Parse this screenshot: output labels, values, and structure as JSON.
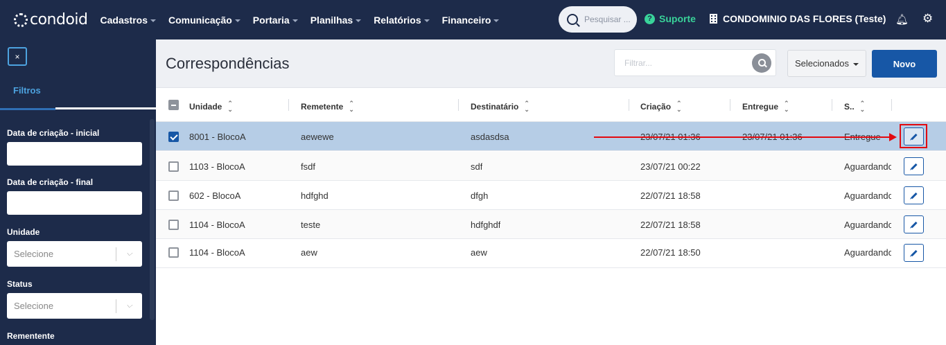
{
  "brand": {
    "name": "condoid"
  },
  "nav": [
    {
      "label": "Cadastros"
    },
    {
      "label": "Comunicação"
    },
    {
      "label": "Portaria"
    },
    {
      "label": "Planilhas"
    },
    {
      "label": "Relatórios"
    },
    {
      "label": "Financeiro"
    }
  ],
  "header": {
    "search_placeholder": "Pesquisar ...",
    "support_label": "Suporte",
    "condo_name": "CONDOMINIO DAS FLORES (Teste)"
  },
  "sidebar": {
    "close_label": "×",
    "tab_label": "Filtros",
    "fields": [
      {
        "label": "Data de criação - inicial",
        "value": ""
      },
      {
        "label": "Data de criação - final",
        "value": ""
      }
    ],
    "selects": [
      {
        "label": "Unidade",
        "value": "Selecione"
      },
      {
        "label": "Status",
        "value": "Selecione"
      }
    ],
    "last_label": "Rementente"
  },
  "page": {
    "title": "Correspondências",
    "filter_placeholder": "Filtrar...",
    "selected_button": "Selecionados",
    "new_button": "Novo"
  },
  "table": {
    "columns": [
      "Unidade",
      "Remetente",
      "Destinatário",
      "Criação",
      "Entregue",
      "S.."
    ],
    "rows": [
      {
        "checked": true,
        "unidade": "8001 - BlocoA",
        "remetente": "aewewe",
        "destinatario": "asdasdsa",
        "criacao": "23/07/21 01:36",
        "entregue": "23/07/21 01:36",
        "status": "Entregue"
      },
      {
        "checked": false,
        "unidade": "1103 - BlocoA",
        "remetente": "fsdf",
        "destinatario": "sdf",
        "criacao": "23/07/21 00:22",
        "entregue": "",
        "status": "Aguardando"
      },
      {
        "checked": false,
        "unidade": "602 - BlocoA",
        "remetente": "hdfghd",
        "destinatario": "dfgh",
        "criacao": "22/07/21 18:58",
        "entregue": "",
        "status": "Aguardando"
      },
      {
        "checked": false,
        "unidade": "1104 - BlocoA",
        "remetente": "teste",
        "destinatario": "hdfghdf",
        "criacao": "22/07/21 18:58",
        "entregue": "",
        "status": "Aguardando"
      },
      {
        "checked": false,
        "unidade": "1104 - BlocoA",
        "remetente": "aew",
        "destinatario": "aew",
        "criacao": "22/07/21 18:50",
        "entregue": "",
        "status": "Aguardando"
      }
    ]
  },
  "colors": {
    "nav_bg": "#1d2b4a",
    "primary": "#1757a6",
    "support": "#39d39a",
    "annotation": "#e3090f",
    "selected_row": "#b6cde6"
  },
  "icons": [
    "search-icon",
    "help-icon",
    "building-icon",
    "bell-icon",
    "gear-icon",
    "close-icon",
    "pencil-icon",
    "sort-icon",
    "chevron-down-icon"
  ]
}
